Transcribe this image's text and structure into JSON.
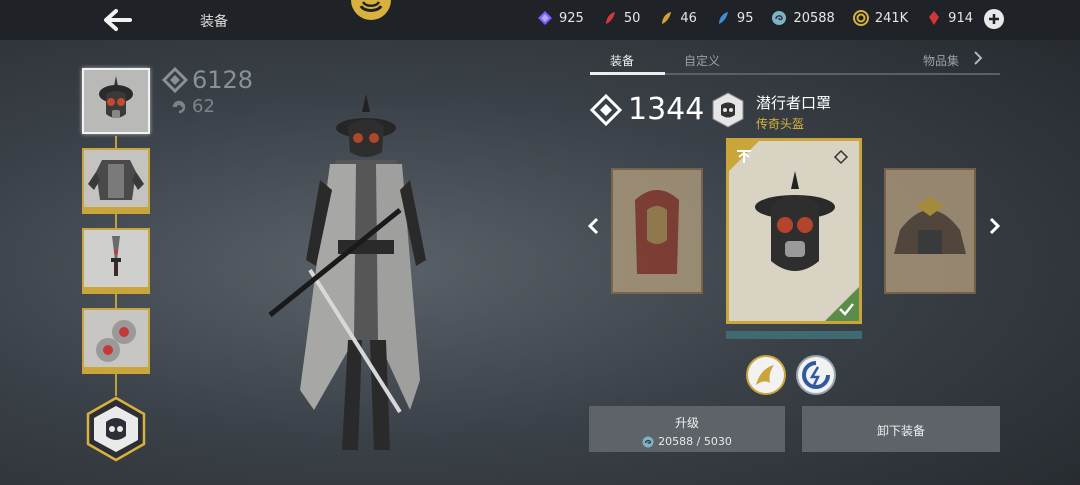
{
  "header": {
    "title": "装备",
    "currencies": [
      {
        "icon": "purple-crystal-icon",
        "value": "925",
        "color": "#7b5cff"
      },
      {
        "icon": "red-feather-icon",
        "value": "50",
        "color": "#d23a3a"
      },
      {
        "icon": "gold-feather-icon",
        "value": "46",
        "color": "#d1a336"
      },
      {
        "icon": "blue-feather-icon",
        "value": "95",
        "color": "#3a8fd8"
      },
      {
        "icon": "coin-swirl-icon",
        "value": "20588",
        "color": "#7fb2c4"
      },
      {
        "icon": "gold-coin-icon",
        "value": "241K",
        "color": "#d8b23c"
      },
      {
        "icon": "ruby-icon",
        "value": "914",
        "color": "#d2363a"
      }
    ]
  },
  "hero": {
    "power": "6128",
    "level": "62"
  },
  "tabs": [
    {
      "label": "装备",
      "active": true
    },
    {
      "label": "自定义",
      "active": false
    },
    {
      "label": "物品集",
      "active": false
    }
  ],
  "item": {
    "power": "1344",
    "name": "潜行者口罩",
    "rarity": "传奇头盔"
  },
  "actions": {
    "upgrade_label": "升级",
    "upgrade_cost": "20588 / 5030",
    "unequip_label": "卸下装备"
  },
  "colors": {
    "gold": "#c9a53a",
    "button": "#5d6368",
    "rarity": "#d9b53c"
  }
}
